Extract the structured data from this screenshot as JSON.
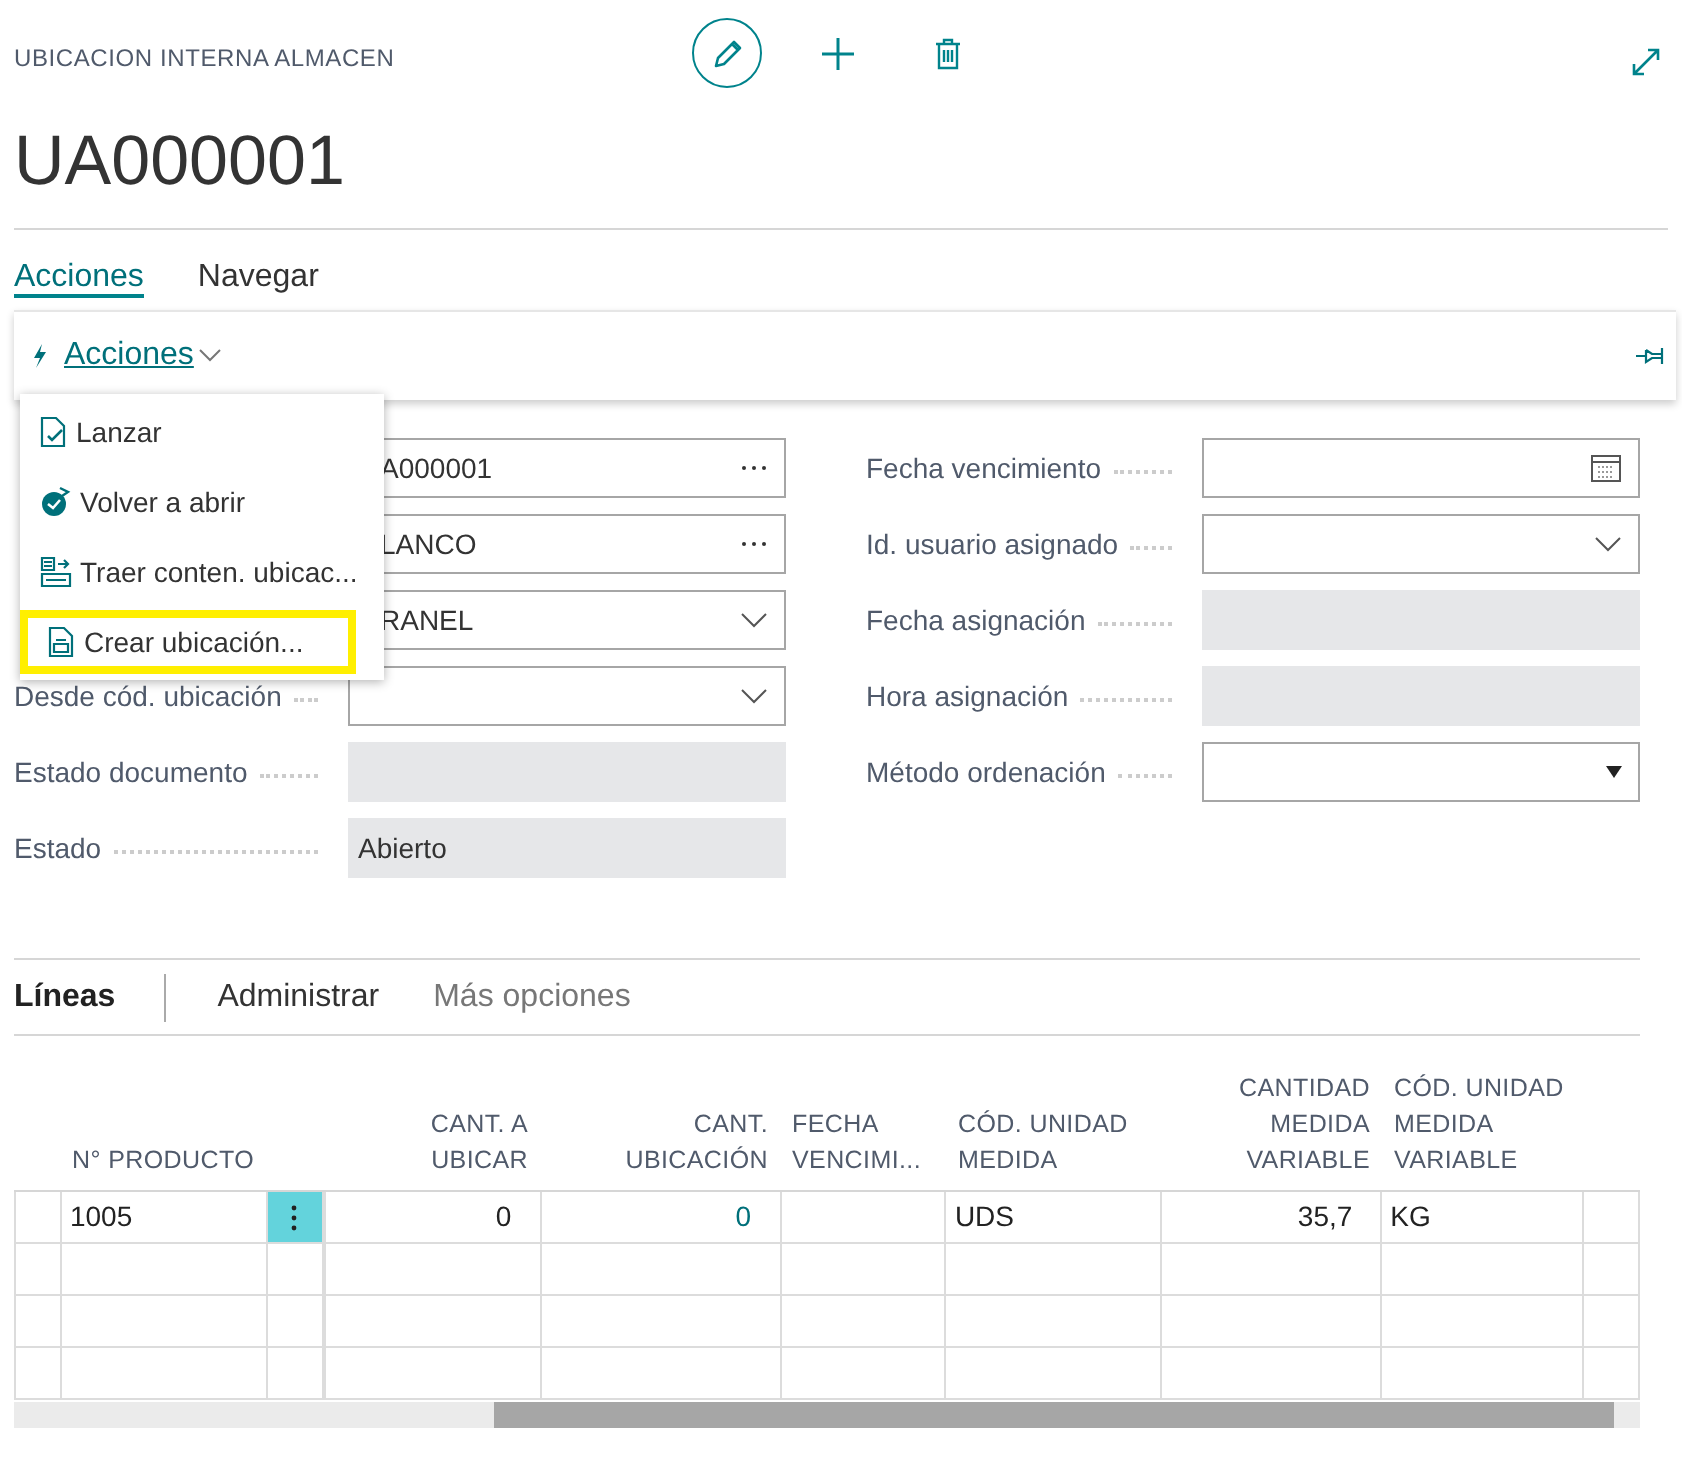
{
  "header": {
    "caption": "UBICACION INTERNA ALMACEN",
    "title": "UA000001",
    "actions": [
      {
        "kind": "edit"
      },
      {
        "kind": "add"
      },
      {
        "kind": "delete"
      }
    ]
  },
  "tabs": [
    {
      "label": "Acciones",
      "selected": true
    },
    {
      "label": "Navegar",
      "selected": false
    }
  ],
  "action_bar": {
    "label": "Acciones"
  },
  "menu": {
    "items": [
      {
        "label": "Lanzar",
        "kind": "release",
        "selected": false
      },
      {
        "label": "Volver a abrir",
        "kind": "reopen",
        "selected": false
      },
      {
        "label": "Traer conten. ubicac...",
        "kind": "fetch",
        "selected": false
      },
      {
        "label": "Crear ubicación...",
        "kind": "create",
        "selected": true
      }
    ]
  },
  "left_fields": [
    {
      "value": "A000001",
      "kind": "lookup"
    },
    {
      "value": "LANCO",
      "kind": "lookup"
    },
    {
      "value": "RANEL",
      "kind": "dropdown"
    },
    {
      "label": "Desde cód. ubicación",
      "kind": "dropdown"
    },
    {
      "label": "Estado documento",
      "kind": "readonly"
    },
    {
      "label": "Estado",
      "value": "Abierto",
      "kind": "readonly"
    }
  ],
  "right_fields": [
    {
      "label": "Fecha vencimiento",
      "kind": "date"
    },
    {
      "label": "Id. usuario asignado",
      "kind": "dropdown"
    },
    {
      "label": "Fecha asignación",
      "kind": "readonly"
    },
    {
      "label": "Hora asignación",
      "kind": "readonly"
    },
    {
      "label": "Método ordenación",
      "kind": "select"
    }
  ],
  "lines": {
    "tabs": [
      {
        "label": "Líneas",
        "selected": true
      },
      {
        "label": "Administrar",
        "selected": false
      },
      {
        "label": "Más opciones",
        "selected": false
      }
    ],
    "columns": [
      "N° PRODUCTO",
      "CANT. A UBICAR",
      "CANT. UBICACIÓN",
      "FECHA VENCIMI...",
      "CÓD. UNIDAD MEDIDA",
      "CANTIDAD MEDIDA VARIABLE",
      "CÓD. UNIDAD MEDIDA VARIABLE"
    ],
    "rows": [
      [
        "1005",
        "0",
        "0",
        "",
        "UDS",
        "35,7",
        "KG"
      ]
    ]
  }
}
